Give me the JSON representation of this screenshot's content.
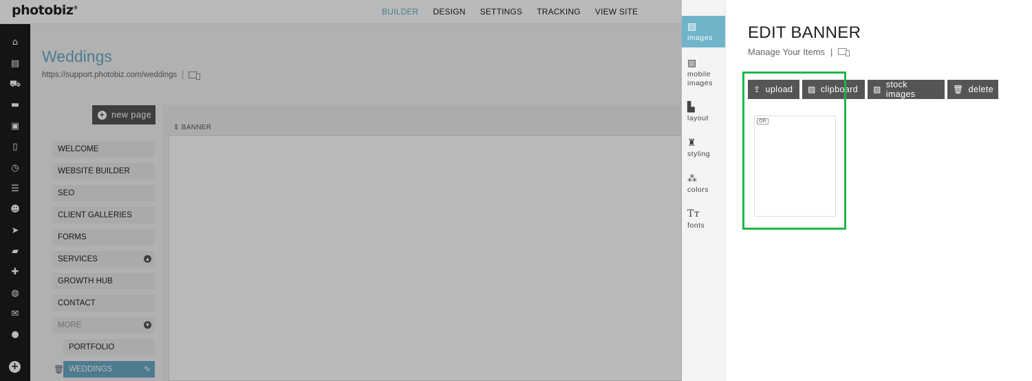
{
  "brand": {
    "logo": "photobiz",
    "logo_mark": "®"
  },
  "top_nav": {
    "items": [
      {
        "label": "BUILDER",
        "active": true
      },
      {
        "label": "DESIGN",
        "active": false
      },
      {
        "label": "SETTINGS",
        "active": false
      },
      {
        "label": "TRACKING",
        "active": false
      },
      {
        "label": "VIEW SITE",
        "active": false
      }
    ]
  },
  "rail": {
    "icons": [
      "home-icon",
      "calendar-icon",
      "cart-icon",
      "chat-icon",
      "gallery-icon",
      "document-icon",
      "schedule-icon",
      "list-icon",
      "contacts-icon",
      "send-icon",
      "folder-icon",
      "puzzle-icon",
      "globe-icon",
      "mail-icon",
      "account-icon"
    ],
    "add_label": "+"
  },
  "page": {
    "title": "Weddings",
    "url": "https://support.photobiz.com/weddings",
    "url_separator": "|"
  },
  "new_page_label": "new page",
  "page_list": [
    {
      "label": "WELCOME"
    },
    {
      "label": "WEBSITE BUILDER"
    },
    {
      "label": "SEO"
    },
    {
      "label": "CLIENT GALLERIES"
    },
    {
      "label": "FORMS"
    },
    {
      "label": "SERVICES"
    },
    {
      "label": "GROWTH HUB"
    },
    {
      "label": "CONTACT"
    },
    {
      "label": "MORE"
    },
    {
      "label": "PORTFOLIO"
    },
    {
      "label": "WEDDINGS"
    }
  ],
  "canvas": {
    "section_label": "BANNER"
  },
  "editor_tabs": [
    {
      "label": "images",
      "icon": "image-icon",
      "active": true
    },
    {
      "label": "mobile images",
      "icon": "image-icon",
      "active": false
    },
    {
      "label": "layout",
      "icon": "layout-icon",
      "active": false
    },
    {
      "label": "styling",
      "icon": "styling-icon",
      "active": false
    },
    {
      "label": "colors",
      "icon": "colors-icon",
      "active": false
    },
    {
      "label": "fonts",
      "icon": "fonts-icon",
      "active": false
    }
  ],
  "editor": {
    "title": "EDIT BANNER",
    "subtitle": "Manage Your Items",
    "separator": "|",
    "buttons": {
      "upload": "upload",
      "clipboard": "clipboard",
      "stock_images": "stock images",
      "delete": "delete"
    },
    "slot_badge": "OR"
  },
  "colors": {
    "accent": "#6aa9c4",
    "highlight": "#1db54a",
    "button": "#555555",
    "rail": "#1c1c1c"
  }
}
